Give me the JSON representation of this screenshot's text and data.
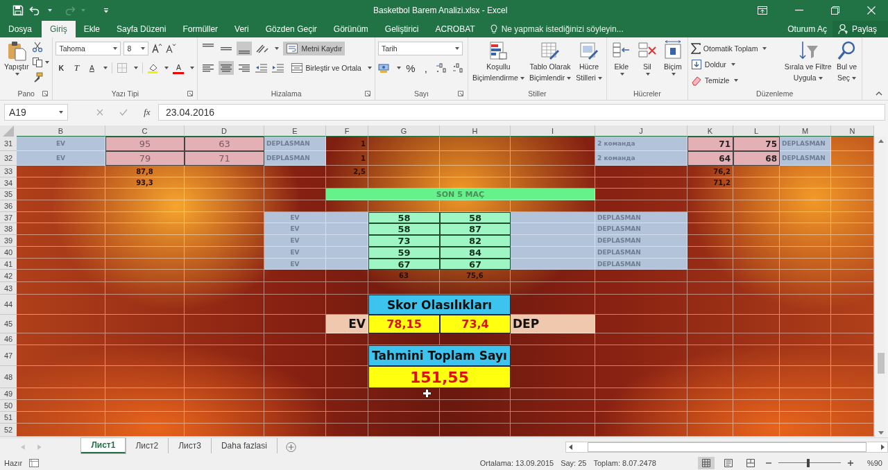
{
  "title_bar": {
    "title": "Basketbol Barem Analizi.xlsx - Excel"
  },
  "tabs": [
    {
      "label": "Dosya",
      "selected": false
    },
    {
      "label": "Giriş",
      "selected": true
    },
    {
      "label": "Ekle",
      "selected": false
    },
    {
      "label": "Sayfa Düzeni",
      "selected": false
    },
    {
      "label": "Formüller",
      "selected": false
    },
    {
      "label": "Veri",
      "selected": false
    },
    {
      "label": "Gözden Geçir",
      "selected": false
    },
    {
      "label": "Görünüm",
      "selected": false
    },
    {
      "label": "Geliştirici",
      "selected": false
    },
    {
      "label": "ACROBAT",
      "selected": false
    }
  ],
  "tell_me": {
    "placeholder": "Ne yapmak istediğinizi söyleyin..."
  },
  "account": {
    "sign_in": "Oturum Aç",
    "share": "Paylaş"
  },
  "clipboard": {
    "label": "Pano",
    "paste": "Yapıştır"
  },
  "font": {
    "label": "Yazı Tipi",
    "name": "Tahoma",
    "size": "8",
    "bold": "K",
    "italic": "T",
    "underline": "A",
    "font_color": "A"
  },
  "alignment": {
    "label": "Hizalama",
    "vertical": [
      {
        "selected": false
      },
      {
        "selected": false
      },
      {
        "selected": true
      }
    ],
    "horizontal": [
      {
        "selected": false
      },
      {
        "selected": true
      },
      {
        "selected": false
      }
    ],
    "wrap_text": {
      "label": "Metni Kaydır",
      "pressed": true
    },
    "merge": "Birleştir ve Ortala"
  },
  "number": {
    "label": "Sayı",
    "format": "Tarih",
    "percent": "%",
    "comma": ","
  },
  "styles": {
    "label": "Stiller",
    "buttons": [
      {
        "kind": "conditional",
        "lines": [
          "Koşullu",
          "Biçimlendirme"
        ]
      },
      {
        "kind": "table",
        "lines": [
          "Tablo Olarak",
          "Biçimlendir"
        ]
      },
      {
        "kind": "cell",
        "lines": [
          "Hücre",
          "Stilleri"
        ]
      }
    ]
  },
  "cells_group": {
    "label": "Hücreler",
    "buttons": [
      {
        "kind": "insert",
        "label": "Ekle"
      },
      {
        "kind": "delete",
        "label": "Sil"
      },
      {
        "kind": "format",
        "label": "Biçim"
      }
    ]
  },
  "editing": {
    "label": "Düzenleme",
    "autosum": "Otomatik Toplam",
    "fill": "Doldur",
    "clear": "Temizle",
    "sort": [
      "Sırala ve Filtre",
      "Uygula"
    ],
    "find": [
      "Bul ve",
      "Seç"
    ]
  },
  "formula_bar": {
    "name_box": "A19",
    "fx": "fx",
    "formula": "23.04.2016"
  },
  "sheet": {
    "columns": [
      "B",
      "C",
      "D",
      "E",
      "F",
      "G",
      "H",
      "I",
      "J",
      "K",
      "L",
      "M",
      "N"
    ],
    "rows": [
      {
        "label": "31",
        "cells": [
          {
            "kind": "home-label",
            "text": "EV"
          },
          {
            "kind": "score",
            "text": "95"
          },
          {
            "kind": "score",
            "text": "63"
          },
          {
            "kind": "away-label",
            "text": "DEPLASMAN"
          },
          {
            "kind": "faint-right",
            "text": "1"
          },
          {
            "kind": "empty"
          },
          {
            "kind": "empty"
          },
          {
            "kind": "empty"
          },
          {
            "kind": "away-label",
            "text": "2 команда"
          },
          {
            "kind": "score-right",
            "text": "71"
          },
          {
            "kind": "score-right",
            "text": "75"
          },
          {
            "kind": "away-label",
            "text": "DEPLASMAN"
          }
        ]
      },
      {
        "label": "32",
        "cells": [
          {
            "kind": "home-label",
            "text": "EV"
          },
          {
            "kind": "score",
            "text": "79"
          },
          {
            "kind": "score",
            "text": "71"
          },
          {
            "kind": "away-label",
            "text": "DEPLASMAN"
          },
          {
            "kind": "faint-right",
            "text": "1"
          },
          {
            "kind": "empty"
          },
          {
            "kind": "empty"
          },
          {
            "kind": "empty"
          },
          {
            "kind": "away-label",
            "text": "2 команда"
          },
          {
            "kind": "score-right",
            "text": "64"
          },
          {
            "kind": "score-right",
            "text": "68"
          },
          {
            "kind": "away-label",
            "text": "DEPLASMAN"
          }
        ]
      },
      {
        "label": "33",
        "cells": [
          {
            "kind": "empty"
          },
          {
            "kind": "faint",
            "text": "87,8"
          },
          {
            "kind": "empty"
          },
          {
            "kind": "empty"
          },
          {
            "kind": "faint-right",
            "text": "2,5"
          },
          {
            "kind": "empty"
          },
          {
            "kind": "empty"
          },
          {
            "kind": "empty"
          },
          {
            "kind": "empty"
          },
          {
            "kind": "faint-right",
            "text": "76,2"
          }
        ]
      },
      {
        "label": "34",
        "cells": [
          {
            "kind": "empty"
          },
          {
            "kind": "faint",
            "text": "93,3"
          },
          {
            "kind": "empty"
          },
          {
            "kind": "empty"
          },
          {
            "kind": "empty"
          },
          {
            "kind": "empty"
          },
          {
            "kind": "empty"
          },
          {
            "kind": "empty"
          },
          {
            "kind": "empty"
          },
          {
            "kind": "faint-right",
            "text": "71,2"
          }
        ]
      },
      {
        "label": "35",
        "cells": [
          {
            "kind": "empty"
          },
          {
            "kind": "empty"
          },
          {
            "kind": "empty"
          },
          {
            "kind": "empty"
          },
          {
            "kind": "section",
            "text": "SON 5 MAÇ"
          },
          {
            "kind": "merged"
          },
          {
            "kind": "merged"
          },
          {
            "kind": "merged"
          }
        ]
      },
      {
        "label": "36"
      },
      {
        "label": "37",
        "cells": [
          {
            "kind": "empty"
          },
          {
            "kind": "empty"
          },
          {
            "kind": "empty"
          },
          {
            "kind": "home-label",
            "text": "EV"
          },
          {
            "kind": "blank-blue"
          },
          {
            "kind": "recent",
            "text": "58"
          },
          {
            "kind": "recent",
            "text": "58"
          },
          {
            "kind": "blank-blue"
          },
          {
            "kind": "away-label",
            "text": "DEPLASMAN"
          }
        ]
      },
      {
        "label": "38",
        "cells": [
          {
            "kind": "empty"
          },
          {
            "kind": "empty"
          },
          {
            "kind": "empty"
          },
          {
            "kind": "home-label",
            "text": "EV"
          },
          {
            "kind": "blank-blue"
          },
          {
            "kind": "recent",
            "text": "58"
          },
          {
            "kind": "recent",
            "text": "87"
          },
          {
            "kind": "blank-blue"
          },
          {
            "kind": "away-label",
            "text": "DEPLASMAN"
          }
        ]
      },
      {
        "label": "39",
        "cells": [
          {
            "kind": "empty"
          },
          {
            "kind": "empty"
          },
          {
            "kind": "empty"
          },
          {
            "kind": "home-label",
            "text": "EV"
          },
          {
            "kind": "blank-blue"
          },
          {
            "kind": "recent",
            "text": "73"
          },
          {
            "kind": "recent",
            "text": "82"
          },
          {
            "kind": "blank-blue"
          },
          {
            "kind": "away-label",
            "text": "DEPLASMAN"
          }
        ]
      },
      {
        "label": "40",
        "cells": [
          {
            "kind": "empty"
          },
          {
            "kind": "empty"
          },
          {
            "kind": "empty"
          },
          {
            "kind": "home-label",
            "text": "EV"
          },
          {
            "kind": "blank-blue"
          },
          {
            "kind": "recent",
            "text": "59"
          },
          {
            "kind": "recent",
            "text": "84"
          },
          {
            "kind": "blank-blue"
          },
          {
            "kind": "away-label",
            "text": "DEPLASMAN"
          }
        ]
      },
      {
        "label": "41",
        "cells": [
          {
            "kind": "empty"
          },
          {
            "kind": "empty"
          },
          {
            "kind": "empty"
          },
          {
            "kind": "home-label",
            "text": "EV"
          },
          {
            "kind": "blank-blue"
          },
          {
            "kind": "recent",
            "text": "67"
          },
          {
            "kind": "recent",
            "text": "67"
          },
          {
            "kind": "blank-blue"
          },
          {
            "kind": "away-label",
            "text": "DEPLASMAN"
          }
        ]
      },
      {
        "label": "42",
        "cells": [
          {
            "kind": "empty"
          },
          {
            "kind": "empty"
          },
          {
            "kind": "empty"
          },
          {
            "kind": "empty"
          },
          {
            "kind": "empty"
          },
          {
            "kind": "faint",
            "text": "63"
          },
          {
            "kind": "faint",
            "text": "75,6"
          }
        ]
      },
      {
        "label": "43"
      },
      {
        "label": "44",
        "cells": [
          {
            "kind": "empty"
          },
          {
            "kind": "empty"
          },
          {
            "kind": "empty"
          },
          {
            "kind": "empty"
          },
          {
            "kind": "empty"
          },
          {
            "kind": "heading",
            "text": "Skor Olasılıkları"
          },
          {
            "kind": "merged"
          }
        ]
      },
      {
        "label": "45",
        "cells": [
          {
            "kind": "empty"
          },
          {
            "kind": "empty"
          },
          {
            "kind": "empty"
          },
          {
            "kind": "empty"
          },
          {
            "kind": "team-right",
            "text": "EV"
          },
          {
            "kind": "result",
            "text": "78,15"
          },
          {
            "kind": "result",
            "text": "73,4"
          },
          {
            "kind": "team-left",
            "text": "DEP"
          }
        ]
      },
      {
        "label": "46"
      },
      {
        "label": "47",
        "cells": [
          {
            "kind": "empty"
          },
          {
            "kind": "empty"
          },
          {
            "kind": "empty"
          },
          {
            "kind": "empty"
          },
          {
            "kind": "empty"
          },
          {
            "kind": "heading",
            "text": "Tahmini Toplam Sayı"
          },
          {
            "kind": "merged"
          }
        ]
      },
      {
        "label": "48",
        "cells": [
          {
            "kind": "empty"
          },
          {
            "kind": "empty"
          },
          {
            "kind": "empty"
          },
          {
            "kind": "empty"
          },
          {
            "kind": "empty"
          },
          {
            "kind": "total",
            "text": "151,55"
          },
          {
            "kind": "merged"
          }
        ]
      },
      {
        "label": "49"
      },
      {
        "label": "50"
      },
      {
        "label": "51"
      },
      {
        "label": "52"
      }
    ]
  },
  "sheet_tabs": [
    {
      "label": "Лист1",
      "selected": true
    },
    {
      "label": "Лист2",
      "selected": false
    },
    {
      "label": "Лист3",
      "selected": false
    },
    {
      "label": "Daha fazlasi",
      "selected": false
    }
  ],
  "status_bar": {
    "ready": "Hazır",
    "average": "Ortalama: 13.09.2015",
    "count": "Say: 25",
    "sum": "Toplam: 8.07.2478",
    "views": [
      {
        "kind": "normal",
        "selected": true
      },
      {
        "kind": "page-layout",
        "selected": false
      },
      {
        "kind": "page-break",
        "selected": false
      }
    ],
    "zoom": {
      "level": 0.48,
      "reading": "%90"
    }
  }
}
